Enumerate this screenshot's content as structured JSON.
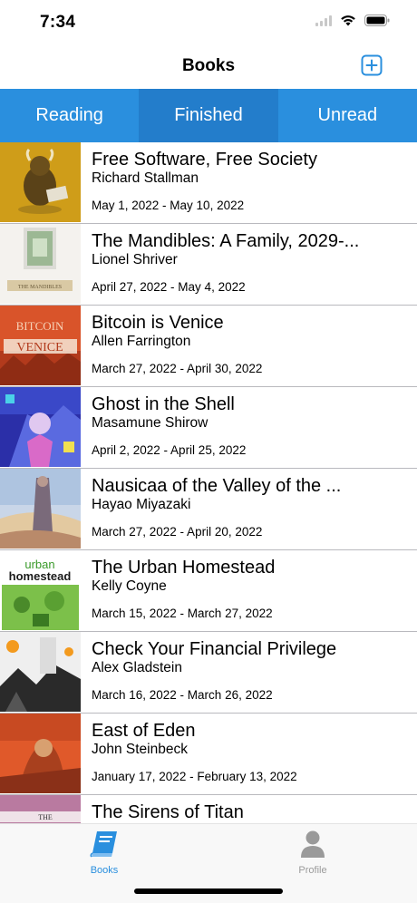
{
  "status": {
    "time": "7:34"
  },
  "nav": {
    "title": "Books"
  },
  "segments": [
    {
      "label": "Reading"
    },
    {
      "label": "Finished"
    },
    {
      "label": "Unread"
    }
  ],
  "books": [
    {
      "title": "Free Software, Free Society",
      "author": "Richard Stallman",
      "dates": "May 1, 2022 - May 10, 2022"
    },
    {
      "title": "The Mandibles: A Family, 2029-...",
      "author": "Lionel Shriver",
      "dates": "April 27, 2022 - May 4, 2022"
    },
    {
      "title": "Bitcoin is Venice",
      "author": "Allen Farrington",
      "dates": "March 27, 2022 - April 30, 2022"
    },
    {
      "title": "Ghost in the Shell",
      "author": "Masamune Shirow",
      "dates": "April 2, 2022 - April 25, 2022"
    },
    {
      "title": "Nausicaa of the Valley of the ...",
      "author": "Hayao Miyazaki",
      "dates": "March 27, 2022 - April 20, 2022"
    },
    {
      "title": "The Urban Homestead",
      "author": "Kelly Coyne",
      "dates": "March 15, 2022 - March 27, 2022"
    },
    {
      "title": "Check Your Financial Privilege",
      "author": "Alex Gladstein",
      "dates": "March 16, 2022 - March 26, 2022"
    },
    {
      "title": "East of Eden",
      "author": "John Steinbeck",
      "dates": "January 17, 2022 - February 13, 2022"
    },
    {
      "title": "The Sirens of Titan",
      "author": "",
      "dates": ""
    }
  ],
  "covers": {
    "free_software": {
      "tagline": ""
    },
    "mandibles": {
      "text": "THE MANDIBLES"
    },
    "bitcoin_venice": {
      "line1": "BITCOIN",
      "line2": "VENICE"
    },
    "urban_homestead": {
      "line1": "urban",
      "line2": "homestead"
    },
    "sirens": {
      "text": "THE"
    }
  },
  "tabs": [
    {
      "label": "Books",
      "icon": "book-icon"
    },
    {
      "label": "Profile",
      "icon": "person-icon"
    }
  ],
  "colors": {
    "accent": "#2a8fde",
    "accent_active": "#237dcb",
    "tab_inactive": "#9a9a9a"
  }
}
